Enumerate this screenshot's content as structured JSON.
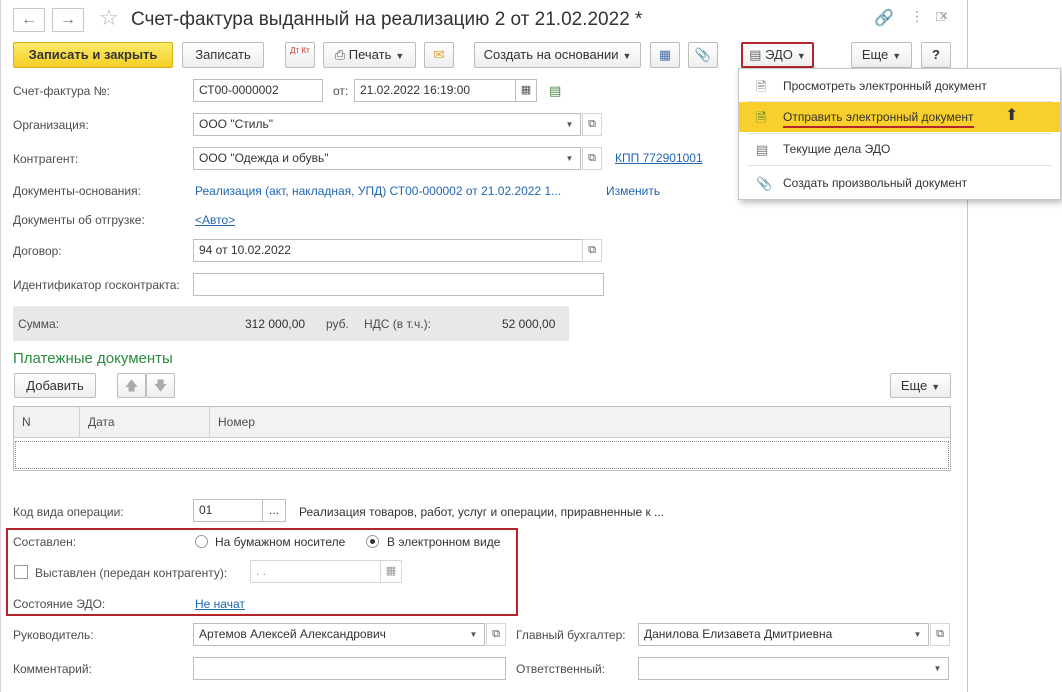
{
  "window": {
    "title": "Счет-фактура выданный на реализацию 2 от 21.02.2022 *",
    "back_icon": "arrow-left-icon",
    "forward_icon": "arrow-right-icon",
    "star_icon": "star-icon"
  },
  "toolbar": {
    "save_close": "Записать и закрыть",
    "save": "Записать",
    "dtkt": "Дт Кт",
    "print": "Печать",
    "create_based": "Создать на основании",
    "edo": "ЭДО",
    "more": "Еще",
    "help": "?"
  },
  "form": {
    "invoice_no_label": "Счет-фактура №:",
    "invoice_no_value": "СТ00-0000002",
    "from_label": "от:",
    "date_value": "21.02.2022 16:19:00",
    "org_label": "Организация:",
    "org_value": "ООО \"Стиль\"",
    "counterparty_label": "Контрагент:",
    "counterparty_value": "ООО \"Одежда и обувь\"",
    "kpp_link": "КПП 772901001",
    "base_docs_label": "Документы-основания:",
    "base_docs_link": "Реализация (акт, накладная, УПД) СТ00-000002 от 21.02.2022 1...",
    "change_link": "Изменить",
    "shipping_docs_label": "Документы об отгрузке:",
    "shipping_docs_link": "<Авто>",
    "contract_label": "Договор:",
    "contract_value": "94 от 10.02.2022",
    "gov_id_label": "Идентификатор госконтракта:",
    "gov_id_value": ""
  },
  "sum": {
    "label": "Сумма:",
    "value": "312 000,00",
    "currency": "руб.",
    "vat_label": "НДС (в т.ч.):",
    "vat_value": "52 000,00"
  },
  "payments": {
    "title": "Платежные документы",
    "add": "Добавить",
    "more": "Еще",
    "columns": [
      "N",
      "Дата",
      "Номер"
    ]
  },
  "operation": {
    "label": "Код вида операции:",
    "code": "01",
    "ellipsis": "...",
    "description": "Реализация товаров, работ, услуг и операции, приравненные к ..."
  },
  "compiled": {
    "label": "Составлен:",
    "paper": "На бумажном носителе",
    "electronic": "В электронном виде",
    "issued_label": "Выставлен (передан контрагенту):",
    "issued_date": " .  .",
    "edo_state_label": "Состояние ЭДО:",
    "edo_state_value": "Не начат"
  },
  "people": {
    "head_label": "Руководитель:",
    "head_value": "Артемов Алексей Александрович",
    "accountant_label": "Главный бухгалтер:",
    "accountant_value": "Данилова Елизавета Дмитриевна",
    "comment_label": "Комментарий:",
    "comment_value": "",
    "responsible_label": "Ответственный:",
    "responsible_value": ""
  },
  "edo_menu": {
    "items": [
      {
        "label": "Просмотреть электронный документ",
        "icon": "document-icon"
      },
      {
        "label": "Отправить электронный документ",
        "icon": "send-document-icon"
      },
      {
        "label": "Текущие дела ЭДО",
        "icon": "edo-tasks-icon"
      },
      {
        "label": "Создать произвольный документ",
        "icon": "paperclip-icon"
      }
    ],
    "highlight_color": "#f8cf2c"
  },
  "colors": {
    "primary_button": "#f4cf24",
    "link": "#2166b3",
    "section_title": "#2b8a3e",
    "highlight_border": "#b3252a"
  }
}
